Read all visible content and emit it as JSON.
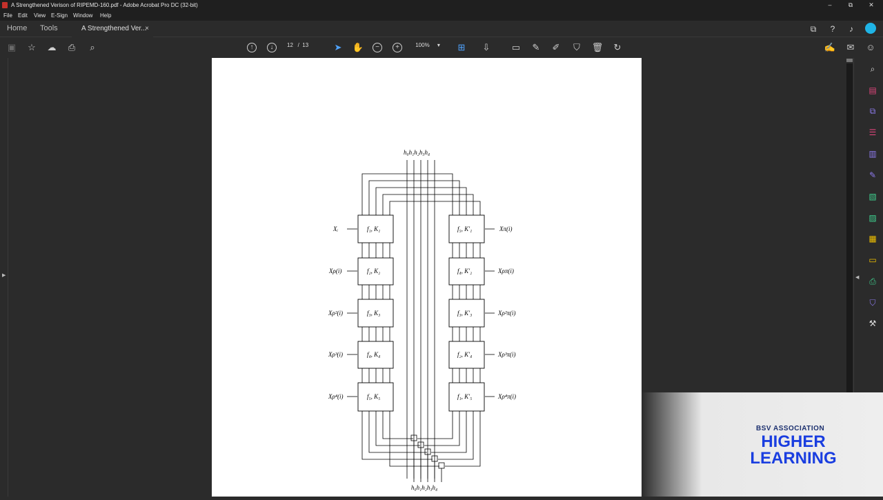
{
  "window": {
    "title": "A Strengthened Verison of RIPEMD-160.pdf - Adobe Acrobat Pro DC (32-bit)",
    "controls": {
      "minimize": "–",
      "maximize": "⧉",
      "close": "✕"
    }
  },
  "menu": [
    "File",
    "Edit",
    "View",
    "E-Sign",
    "Window",
    "Help"
  ],
  "tabs": {
    "home": "Home",
    "tools": "Tools",
    "doc": "A Strengthened Ver...",
    "close": "×"
  },
  "toolbar": {
    "page_current": "12",
    "page_sep": "/",
    "page_total": "13",
    "zoom": "100%",
    "zoom_caret": "▾"
  },
  "diagram": {
    "top_label": "h₀h₁h₂h₃h₄",
    "bottom_label": "h₀h₁h₂h₃h₄",
    "left_boxes": [
      "f₁, K₁",
      "f₂, K₂",
      "f₃, K₃",
      "f₄, K₄",
      "f₅, K₅"
    ],
    "right_boxes": [
      "f₅, K′₁",
      "f₄, K′₂",
      "f₃, K′₃",
      "f₂, K′₄",
      "f₁, K′₅"
    ],
    "left_inputs": [
      "Xᵢ",
      "Xρ(i)",
      "Xρ²(i)",
      "Xρ³(i)",
      "Xρ⁴(i)"
    ],
    "right_inputs": [
      "Xπ(i)",
      "Xρπ(i)",
      "Xρ²π(i)",
      "Xρ³π(i)",
      "Xρ⁴π(i)"
    ]
  },
  "banner": {
    "line1": "BSV ASSOCIATION",
    "line2": "HIGHER",
    "line3": "LEARNING"
  },
  "colors": {
    "accent": "#1fb4e6",
    "banner_text": "#1a3ee0",
    "pdf_icon": "#c4312b"
  }
}
